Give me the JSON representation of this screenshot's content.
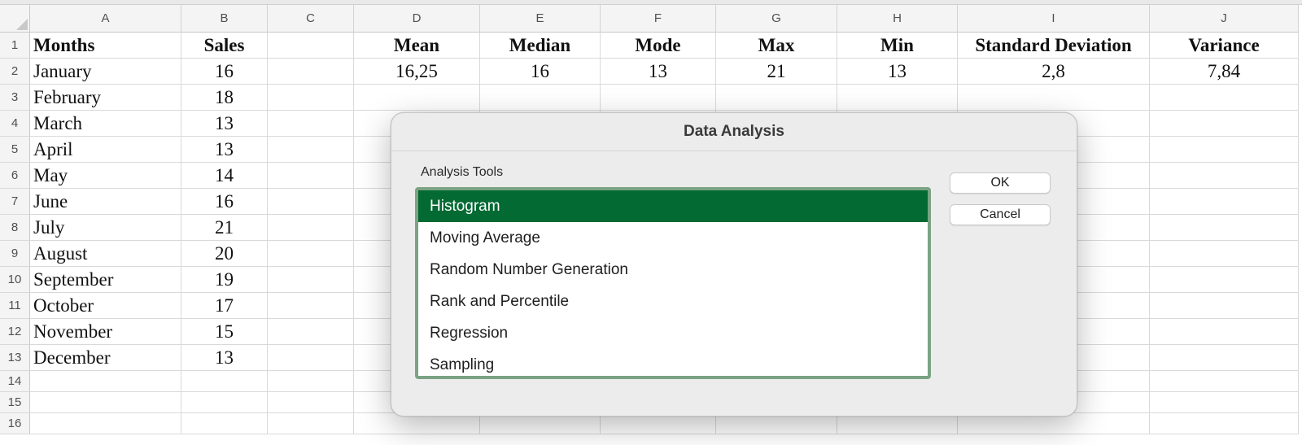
{
  "sheet": {
    "columns": [
      "A",
      "B",
      "C",
      "D",
      "E",
      "F",
      "G",
      "H",
      "I",
      "J"
    ],
    "row_numbers": [
      "1",
      "2",
      "3",
      "4",
      "5",
      "6",
      "7",
      "8",
      "9",
      "10",
      "11",
      "12",
      "13",
      "14",
      "15",
      "16"
    ],
    "header": {
      "months": "Months",
      "sales": "Sales",
      "mean": "Mean",
      "median": "Median",
      "mode": "Mode",
      "max": "Max",
      "min": "Min",
      "stddev": "Standard Deviation",
      "variance": "Variance"
    },
    "stats": {
      "mean": "16,25",
      "median": "16",
      "mode": "13",
      "max": "21",
      "min": "13",
      "stddev": "2,8",
      "variance": "7,84"
    },
    "months": [
      "January",
      "February",
      "March",
      "April",
      "May",
      "June",
      "July",
      "August",
      "September",
      "October",
      "November",
      "December"
    ],
    "sales": [
      "16",
      "18",
      "13",
      "13",
      "14",
      "16",
      "21",
      "20",
      "19",
      "17",
      "15",
      "13"
    ]
  },
  "dialog": {
    "title": "Data Analysis",
    "tools_label": "Analysis Tools",
    "items": [
      "Histogram",
      "Moving Average",
      "Random Number Generation",
      "Rank and Percentile",
      "Regression",
      "Sampling"
    ],
    "selected_item": "Histogram",
    "ok_label": "OK",
    "cancel_label": "Cancel",
    "selection_color": "#036a33",
    "list_border_color": "#7ba384"
  }
}
